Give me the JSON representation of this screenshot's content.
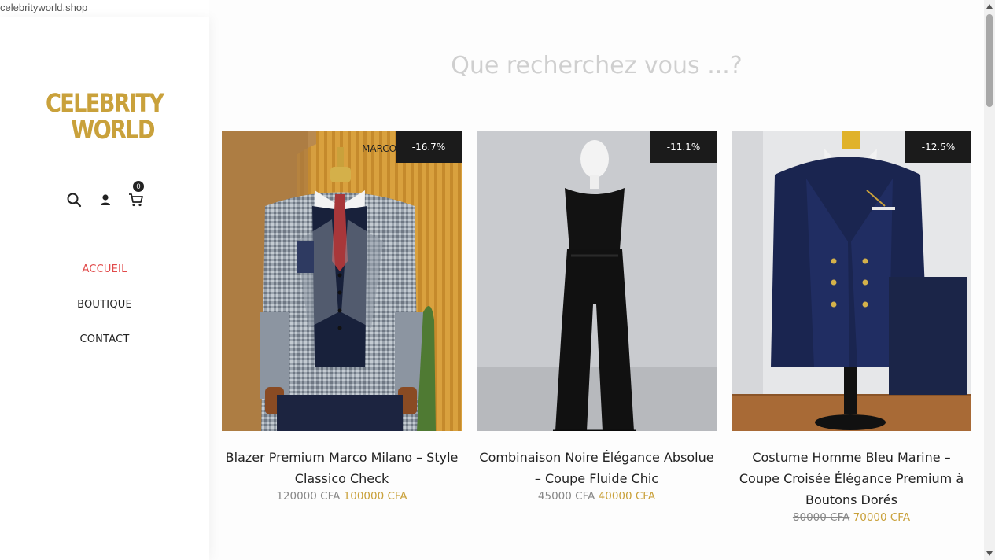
{
  "site": {
    "url_label": "celebrityworld.shop"
  },
  "brand": {
    "line1": "CELEBRITY",
    "line2": "WORLD",
    "color": "#c9a13b"
  },
  "header_icons": [
    {
      "icon": "search-icon"
    },
    {
      "icon": "user-icon"
    },
    {
      "icon": "cart-icon",
      "count": "0"
    }
  ],
  "nav": [
    {
      "label": "ACCUEIL",
      "active": true
    },
    {
      "label": "BOUTIQUE",
      "active": false
    },
    {
      "label": "CONTACT",
      "active": false
    }
  ],
  "search": {
    "title": "Que recherchez vous ...?"
  },
  "products": [
    {
      "name": "Blazer Premium Marco Milano – Style Classico Check",
      "old_price": "120000 CFA",
      "new_price": "100000 CFA",
      "discount": "-16.7%",
      "tag_text": "MARCO"
    },
    {
      "name": "Combinaison Noire Élégance Absolue – Coupe Fluide Chic",
      "old_price": "45000 CFA",
      "new_price": "40000 CFA",
      "discount": "-11.1%"
    },
    {
      "name": "Costume Homme Bleu Marine – Coupe Croisée Élégance Premium à Boutons Dorés",
      "old_price": "80000 CFA",
      "new_price": "70000 CFA",
      "discount": "-12.5%"
    }
  ],
  "colors": {
    "active_nav": "#e14a4a",
    "price_new": "#c9a13b",
    "badge_bg": "#1b1b1b"
  }
}
